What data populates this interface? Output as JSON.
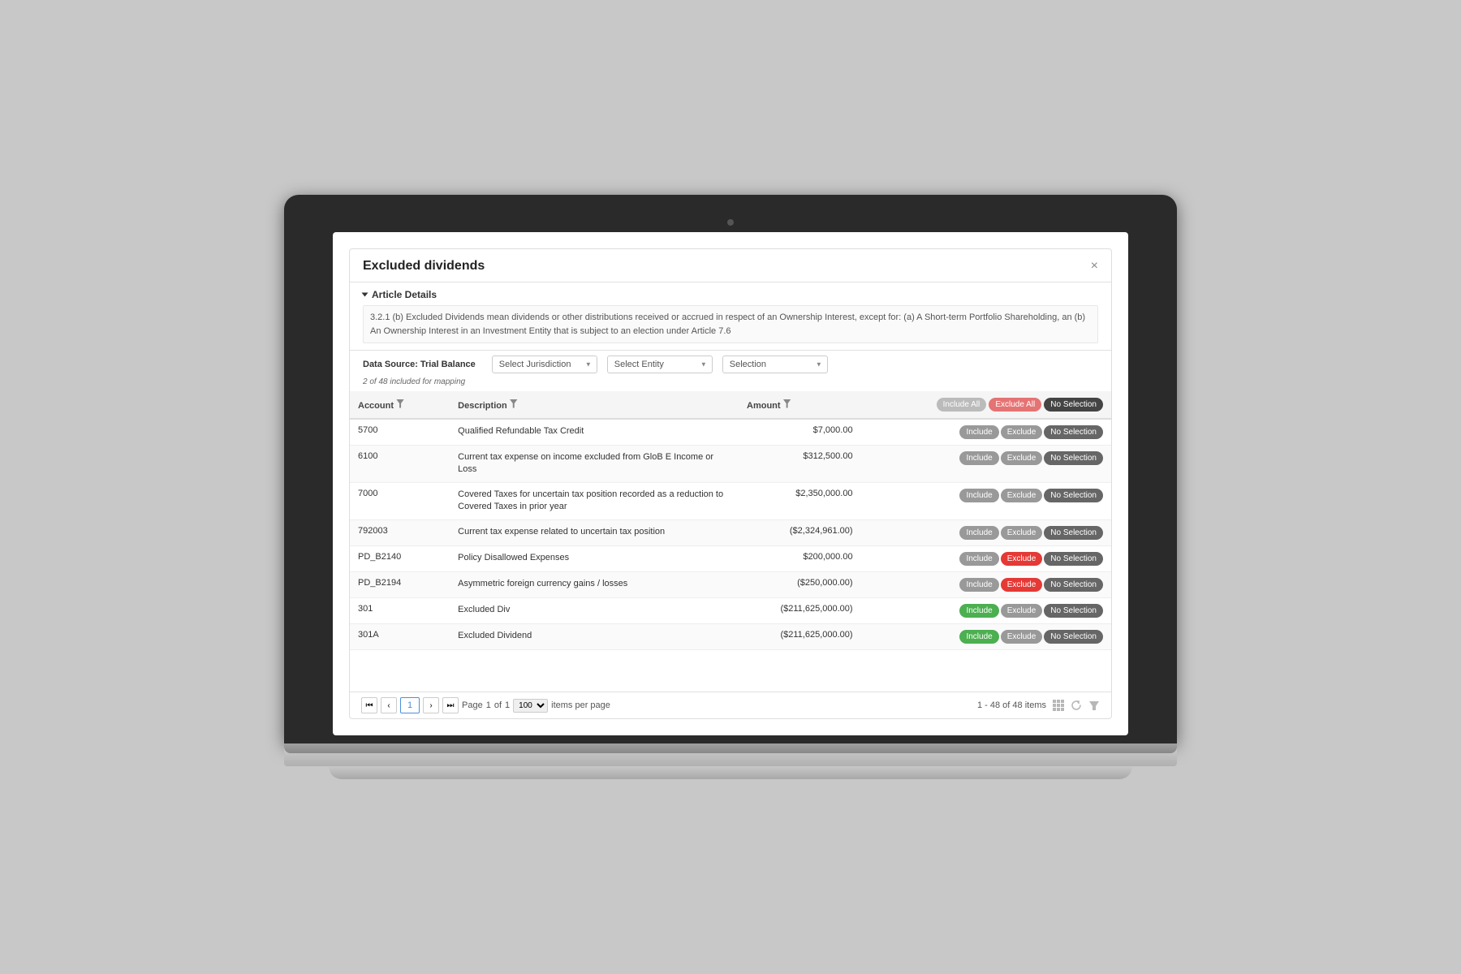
{
  "modal": {
    "title": "Excluded dividends",
    "close_label": "×"
  },
  "article": {
    "section_label": "Article Details",
    "text": "3.2.1 (b) Excluded Dividends mean dividends or other distributions received or accrued in respect of an Ownership Interest, except for: (a) A Short-term Portfolio Shareholding, an (b) An Ownership Interest in an Investment Entity that is subject to an election under Article 7.6"
  },
  "datasource": {
    "label": "Data Source: Trial Balance",
    "mapping_info": "2 of 48 included for mapping"
  },
  "filters": {
    "jurisdiction_placeholder": "Select Jurisdiction",
    "entity_placeholder": "Select Entity",
    "selection_placeholder": "Selection"
  },
  "columns": {
    "account": "Account",
    "description": "Description",
    "amount": "Amount"
  },
  "header_buttons": {
    "include_all": "Include All",
    "exclude_all": "Exclude All",
    "no_selection": "No Selection"
  },
  "rows": [
    {
      "account": "5700",
      "description": "Qualified Refundable Tax Credit",
      "amount": "$7,000.00",
      "include_active": false,
      "exclude_active": false,
      "no_select_active": false
    },
    {
      "account": "6100",
      "description": "Current tax expense on income excluded from GloB E Income or Loss",
      "amount": "$312,500.00",
      "include_active": false,
      "exclude_active": false,
      "no_select_active": false
    },
    {
      "account": "7000",
      "description": "Covered Taxes for uncertain tax position recorded as a reduction to Covered Taxes in prior year",
      "amount": "$2,350,000.00",
      "include_active": false,
      "exclude_active": false,
      "no_select_active": false
    },
    {
      "account": "792003",
      "description": "Current tax expense related to uncertain tax position",
      "amount": "($2,324,961.00)",
      "include_active": false,
      "exclude_active": false,
      "no_select_active": false
    },
    {
      "account": "PD_B2140",
      "description": "Policy Disallowed Expenses",
      "amount": "$200,000.00",
      "include_active": false,
      "exclude_active": true,
      "no_select_active": false
    },
    {
      "account": "PD_B2194",
      "description": "Asymmetric foreign currency gains / losses",
      "amount": "($250,000.00)",
      "include_active": false,
      "exclude_active": true,
      "no_select_active": false
    },
    {
      "account": "301",
      "description": "Excluded Div",
      "amount": "($211,625,000.00)",
      "include_active": true,
      "exclude_active": false,
      "no_select_active": false
    },
    {
      "account": "301A",
      "description": "Excluded Dividend",
      "amount": "($211,625,000.00)",
      "include_active": true,
      "exclude_active": false,
      "no_select_active": false
    }
  ],
  "pagination": {
    "current_page": "1",
    "page_label": "Page",
    "of_label": "of",
    "total_pages": "1",
    "items_per_page": "100",
    "items_info": "1 - 48 of 48 items"
  }
}
